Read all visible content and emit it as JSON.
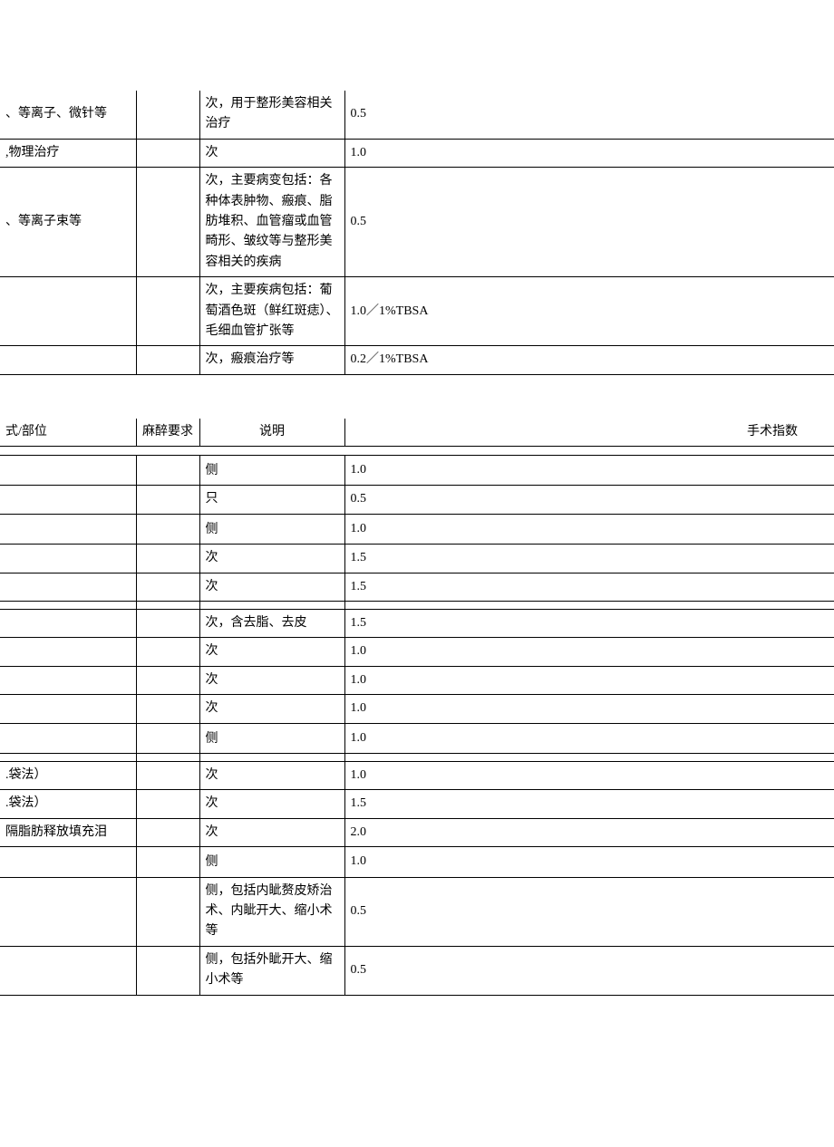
{
  "table1": {
    "rows": [
      {
        "c1": "、等离子、微针等",
        "c3": "次，用于整形美容相关治疗",
        "c4": "0.5"
      },
      {
        "c1": ",物理治疗",
        "c3": "次",
        "c4": "1.0"
      },
      {
        "c1": "、等离子束等",
        "c3": "次，主要病变包括：各种体表肿物、瘢痕、脂肪堆积、血管瘤或血管畸形、皱纹等与整形美容相关的疾病",
        "c4": "0.5"
      },
      {
        "c1": "",
        "c3": "次，主要疾病包括：葡萄酒色斑（鲜红斑痣）、毛细血管扩张等",
        "c4": "1.0／1%TBSA"
      },
      {
        "c1": "",
        "c3": "次，瘢痕治疗等",
        "c4": "0.2／1%TBSA"
      }
    ]
  },
  "table2": {
    "headers": {
      "c1": "式/部位",
      "c2": "麻醉要求",
      "c3": "说明",
      "c4": "手术指数"
    },
    "rows": [
      {
        "c3": "侧",
        "c4": "1.0",
        "bold": true
      },
      {
        "c3": "只",
        "c4": "0.5"
      },
      {
        "c3": "侧",
        "c4": "1.0",
        "bold": true
      },
      {
        "c3": "次",
        "c4": "1.5"
      },
      {
        "c3": "次",
        "c4": "1.5"
      },
      {
        "spacer": true
      },
      {
        "c3": "次，含去脂、去皮",
        "c4": "1.5"
      },
      {
        "c3": "次",
        "c4": "1.0"
      },
      {
        "c3": "次",
        "c4": "1.0"
      },
      {
        "c3": "次",
        "c4": "1.0"
      },
      {
        "c3": "侧",
        "c4": "1.0",
        "bold": true
      },
      {
        "spacer": true
      },
      {
        "c1": ".袋法）",
        "c3": "次",
        "c4": "1.0"
      },
      {
        "c1": ".袋法）",
        "c3": "次",
        "c4": "1.5"
      },
      {
        "c1": "隔脂肪释放填充泪",
        "c3": "次",
        "c4": "2.0"
      },
      {
        "c3": "侧",
        "c4": "1.0",
        "bold": true
      },
      {
        "c3": "侧，包括内眦赘皮矫治术、内眦开大、缩小术等",
        "c4": "0.5"
      },
      {
        "c3": "侧，包括外眦开大、缩小术等",
        "c4": "0.5"
      }
    ]
  }
}
